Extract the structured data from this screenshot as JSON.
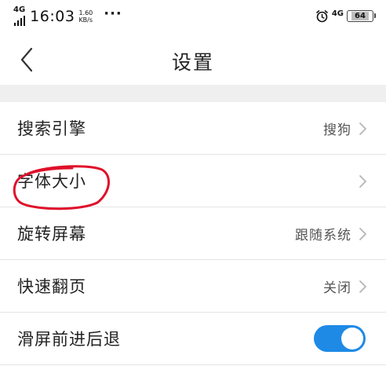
{
  "status_bar": {
    "network_left": "4G",
    "time": "16:03",
    "speed_value": "1.60",
    "speed_unit": "KB/s",
    "more": "···",
    "network_right": "4G",
    "battery": "64"
  },
  "header": {
    "title": "设置"
  },
  "settings": [
    {
      "label": "搜索引擎",
      "value": "搜狗"
    },
    {
      "label": "字体大小",
      "value": ""
    },
    {
      "label": "旋转屏幕",
      "value": "跟随系统"
    },
    {
      "label": "快速翻页",
      "value": "关闭"
    },
    {
      "label": "滑屏前进后退",
      "toggle_on": true
    }
  ],
  "colors": {
    "toggle": "#1e8ae6",
    "annotation": "#e0102a",
    "band": "#efefef"
  }
}
